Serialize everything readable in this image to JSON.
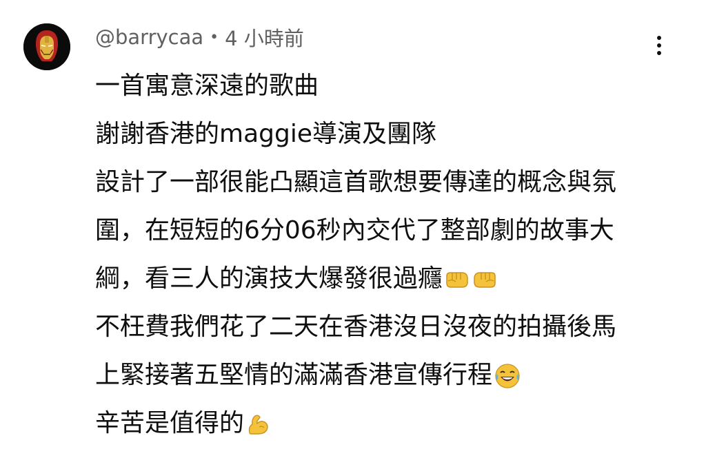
{
  "comment": {
    "author_handle": "@barrycaa",
    "separator": "•",
    "timestamp": "4 小時前",
    "avatar_icon": "iron-man-helmet-icon",
    "lines": [
      {
        "text": "一首寓意深遠的歌曲"
      },
      {
        "text": "謝謝香港的maggie導演及團隊"
      },
      {
        "text": "設計了一部很能凸顯這首歌想要傳達的概念與氛"
      },
      {
        "text": "圍，在短短的6分06秒內交代了整部劇的故事大"
      },
      {
        "text": "綱，看三人的演技大爆發很過癮",
        "emojis": [
          "left-facing-fist-icon",
          "right-facing-fist-icon"
        ]
      },
      {
        "text": "不枉費我們花了二天在香港沒日沒夜的拍攝後馬"
      },
      {
        "text": "上緊接著五堅情的滿滿香港宣傳行程",
        "emojis": [
          "laughing-tears-icon"
        ]
      },
      {
        "text": "辛苦是值得的",
        "emojis": [
          "flexed-biceps-icon"
        ]
      }
    ]
  },
  "colors": {
    "text_primary": "#0f0f0f",
    "text_secondary": "#606060",
    "avatar_bg": "#0b0b0b",
    "helmet_red": "#b3241e",
    "helmet_gold": "#e3b341",
    "emoji_yellow": "#f5c33b"
  }
}
